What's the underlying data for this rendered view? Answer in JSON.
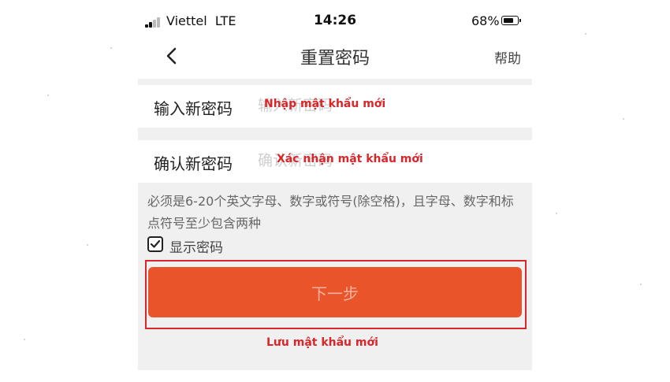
{
  "status_bar": {
    "carrier": "Viettel",
    "network": "LTE",
    "time": "14:26",
    "battery_percent": "68%",
    "icons": [
      "signal-icon",
      "battery-icon"
    ]
  },
  "nav": {
    "back_icon": "chevron-left-icon",
    "title": "重置密码",
    "help": "帮助"
  },
  "form": {
    "new_password": {
      "label": "输入新密码",
      "placeholder": "输入新密码",
      "annotation": "Nhập mật khẩu mới"
    },
    "confirm_password": {
      "label": "确认新密码",
      "placeholder": "确认新密码",
      "annotation": "Xác nhận mật khẩu mới"
    },
    "hint": "必须是6-20个英文字母、数字或符号(除空格)，且字母、数字和标点符号至少包含两种",
    "show_password": {
      "label": "显示密码",
      "checked": true,
      "icon": "checkbox-checked-icon"
    },
    "next_button": {
      "label": "下一步",
      "annotation": "Lưu mật khẩu mới"
    }
  },
  "colors": {
    "accent": "#e9542a",
    "annotation_red": "#d9262b",
    "background_gray": "#f0f0f0"
  }
}
